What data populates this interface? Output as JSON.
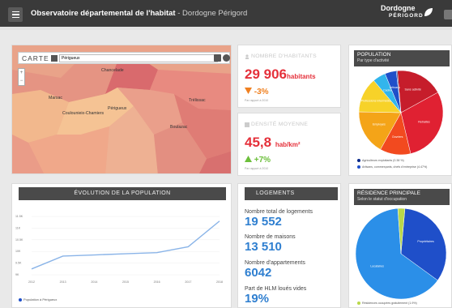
{
  "header": {
    "title_main": "Observatoire départemental de l'habitat",
    "title_sep": " - ",
    "title_sub": "Dordogne Périgord",
    "logo_line1": "Dordogne",
    "logo_line2": "PÉRIGORD"
  },
  "map": {
    "label": "CARTE",
    "search_value": "Périgueux",
    "zoom_in": "+",
    "zoom_out": "−",
    "towns": [
      "Chancelade",
      "Coulounieix-Chamiers",
      "Périgueux",
      "Trélissac",
      "Boulazac",
      "Marsac"
    ]
  },
  "habitants": {
    "title": "NOMBRE D'HABITANTS",
    "value": "29 906",
    "unit": "habitants",
    "variation": "-3%",
    "note": "Par rapport à 2010",
    "trend": "down"
  },
  "densite": {
    "title": "DENSITÉ MOYENNE",
    "value": "45,8",
    "unit": "hab/km²",
    "variation": "+7%",
    "note": "Par rapport à 2010",
    "trend": "up"
  },
  "population_pie": {
    "title": "POPULATION",
    "subtitle": "Par type d'activité",
    "legend": [
      "Agriculteurs exploitants (0.38 %)",
      "Artisans, commerçants, chefs d'entreprise (4.47%)"
    ],
    "slices": [
      {
        "label": "Sans activité",
        "value": 18.4,
        "color": "#c61d2b"
      },
      {
        "label": "Retraités",
        "value": 29.3,
        "color": "#e02132"
      },
      {
        "label": "Ouvriers",
        "value": 11.8,
        "color": "#f24a1f"
      },
      {
        "label": "Employés",
        "value": 17.2,
        "color": "#f4a418"
      },
      {
        "label": "Professions intermédiaires",
        "value": 13.5,
        "color": "#f7d229"
      },
      {
        "label": "Cadres",
        "value": 5.0,
        "color": "#32b5ec"
      },
      {
        "label": "Artisans",
        "value": 4.4,
        "color": "#1f4fc9"
      },
      {
        "label": "Agriculteurs",
        "value": 0.4,
        "color": "#0a2a8a"
      }
    ]
  },
  "evolution": {
    "title": "ÉVOLUTION DE LA POPULATION",
    "legend": "Population à Périgueux",
    "chart_data": {
      "type": "line",
      "x": [
        "2012",
        "2013",
        "2014",
        "2015",
        "2016",
        "2017",
        "2018"
      ],
      "y_ticks": [
        "11.5K",
        "11K",
        "10.5K",
        "10K",
        "9.5K",
        "9K"
      ],
      "series": [
        {
          "name": "Population à Périgueux",
          "values": [
            9.25,
            9.8,
            9.85,
            9.9,
            9.95,
            10.2,
            11.3
          ]
        }
      ],
      "ylim": [
        9,
        11.5
      ],
      "color": "#8ab4e8"
    }
  },
  "logements": {
    "title": "LOGEMENTS",
    "total_label": "Nombre total de logements",
    "total_value": "19 552",
    "maisons_label": "Nombre de maisons",
    "maisons_value": "13 510",
    "appart_label": "Nombre d'appartements",
    "appart_value": "6042",
    "hlm_label": "Part de HLM loués vides",
    "hlm_value": "19%"
  },
  "residence_pie": {
    "title": "RÉSIDENCE PRINCIPALE",
    "subtitle": "Selon le statut d'occupation",
    "legend": [
      "Résidences occupées gratuitement (1.9%)"
    ],
    "slices": [
      {
        "label": "Propriétaires",
        "value": 33.6,
        "color": "#1f4fc9"
      },
      {
        "label": "Locataires",
        "value": 63.9,
        "color": "#2b8fe8"
      },
      {
        "label": "Gratuit",
        "value": 2.5,
        "color": "#b9d84a"
      }
    ]
  }
}
